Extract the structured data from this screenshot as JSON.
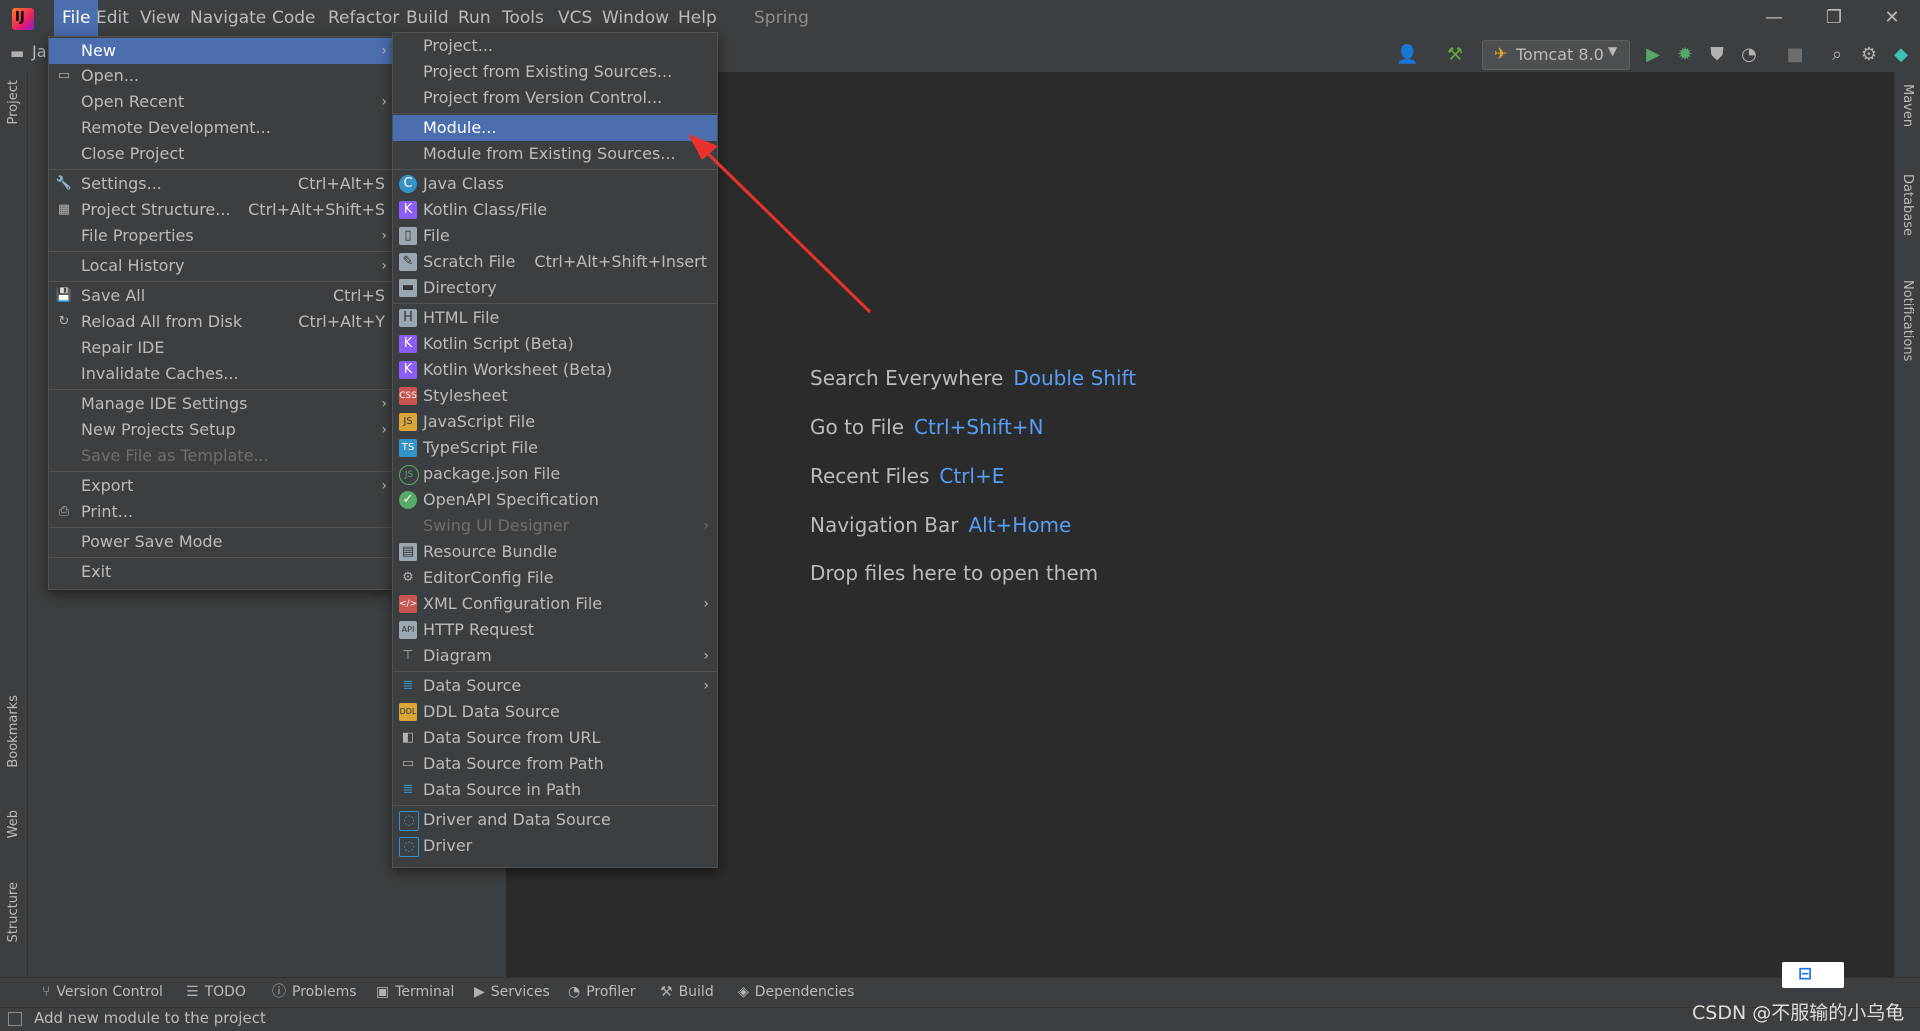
{
  "menubar": {
    "items": [
      "File",
      "Edit",
      "View",
      "Navigate",
      "Code",
      "Refactor",
      "Build",
      "Run",
      "Tools",
      "VCS",
      "Window",
      "Help"
    ],
    "project": "Spring",
    "win_min": "—",
    "win_restore": "❐",
    "win_close": "✕"
  },
  "toolbar": {
    "run_config": "Tomcat 8.0"
  },
  "left_strip": {
    "project": "Project",
    "bookmarks": "Bookmarks",
    "web": "Web",
    "structure": "Structure",
    "ja": "Ja"
  },
  "right_strip": {
    "maven": "Maven",
    "database": "Database",
    "notifications": "Notifications"
  },
  "file_menu": {
    "items": [
      {
        "label": "New",
        "accel": "",
        "arrow": true
      },
      {
        "label": "Open...",
        "accel": "",
        "arrow": false
      },
      {
        "label": "Open Recent",
        "accel": "",
        "arrow": true
      },
      {
        "label": "Remote Development...",
        "accel": "",
        "arrow": false
      },
      {
        "label": "Close Project",
        "accel": "",
        "arrow": false
      },
      {
        "label": "Settings...",
        "accel": "Ctrl+Alt+S",
        "arrow": false
      },
      {
        "label": "Project Structure...",
        "accel": "Ctrl+Alt+Shift+S",
        "arrow": false
      },
      {
        "label": "File Properties",
        "accel": "",
        "arrow": true
      },
      {
        "label": "Local History",
        "accel": "",
        "arrow": true
      },
      {
        "label": "Save All",
        "accel": "Ctrl+S",
        "arrow": false
      },
      {
        "label": "Reload All from Disk",
        "accel": "Ctrl+Alt+Y",
        "arrow": false
      },
      {
        "label": "Repair IDE",
        "accel": "",
        "arrow": false
      },
      {
        "label": "Invalidate Caches...",
        "accel": "",
        "arrow": false
      },
      {
        "label": "Manage IDE Settings",
        "accel": "",
        "arrow": true
      },
      {
        "label": "New Projects Setup",
        "accel": "",
        "arrow": true
      },
      {
        "label": "Save File as Template...",
        "accel": "",
        "arrow": false
      },
      {
        "label": "Export",
        "accel": "",
        "arrow": true
      },
      {
        "label": "Print...",
        "accel": "",
        "arrow": false
      },
      {
        "label": "Power Save Mode",
        "accel": "",
        "arrow": false
      },
      {
        "label": "Exit",
        "accel": "",
        "arrow": false
      }
    ]
  },
  "new_menu": {
    "items": [
      {
        "label": "Project...",
        "accel": ""
      },
      {
        "label": "Project from Existing Sources...",
        "accel": ""
      },
      {
        "label": "Project from Version Control...",
        "accel": ""
      },
      {
        "label": "Module...",
        "accel": ""
      },
      {
        "label": "Module from Existing Sources...",
        "accel": ""
      },
      {
        "label": "Java Class",
        "accel": ""
      },
      {
        "label": "Kotlin Class/File",
        "accel": ""
      },
      {
        "label": "File",
        "accel": ""
      },
      {
        "label": "Scratch File",
        "accel": "Ctrl+Alt+Shift+Insert"
      },
      {
        "label": "Directory",
        "accel": ""
      },
      {
        "label": "HTML File",
        "accel": ""
      },
      {
        "label": "Kotlin Script (Beta)",
        "accel": ""
      },
      {
        "label": "Kotlin Worksheet (Beta)",
        "accel": ""
      },
      {
        "label": "Stylesheet",
        "accel": ""
      },
      {
        "label": "JavaScript File",
        "accel": ""
      },
      {
        "label": "TypeScript File",
        "accel": ""
      },
      {
        "label": "package.json File",
        "accel": ""
      },
      {
        "label": "OpenAPI Specification",
        "accel": ""
      },
      {
        "label": "Swing UI Designer",
        "accel": ""
      },
      {
        "label": "Resource Bundle",
        "accel": ""
      },
      {
        "label": "EditorConfig File",
        "accel": ""
      },
      {
        "label": "XML Configuration File",
        "accel": ""
      },
      {
        "label": "HTTP Request",
        "accel": ""
      },
      {
        "label": "Diagram",
        "accel": ""
      },
      {
        "label": "Data Source",
        "accel": ""
      },
      {
        "label": "DDL Data Source",
        "accel": ""
      },
      {
        "label": "Data Source from URL",
        "accel": ""
      },
      {
        "label": "Data Source from Path",
        "accel": ""
      },
      {
        "label": "Data Source in Path",
        "accel": ""
      },
      {
        "label": "Driver and Data Source",
        "accel": ""
      },
      {
        "label": "Driver",
        "accel": ""
      }
    ]
  },
  "welcome": {
    "hints": [
      {
        "label": "Search Everywhere",
        "shortcut": "Double Shift"
      },
      {
        "label": "Go to File",
        "shortcut": "Ctrl+Shift+N"
      },
      {
        "label": "Recent Files",
        "shortcut": "Ctrl+E"
      },
      {
        "label": "Navigation Bar",
        "shortcut": "Alt+Home"
      },
      {
        "label": "Drop files here to open them",
        "shortcut": ""
      }
    ]
  },
  "bottom_tabs": [
    "Version Control",
    "TODO",
    "Problems",
    "Terminal",
    "Services",
    "Profiler",
    "Build",
    "Dependencies"
  ],
  "status": {
    "text": "Add new module to the project",
    "watermark": "CSDN @不服输的小乌龟"
  },
  "colors": {
    "accent": "#4b6eaf",
    "shortcut": "#589df6",
    "arrow": "#e8322b"
  }
}
